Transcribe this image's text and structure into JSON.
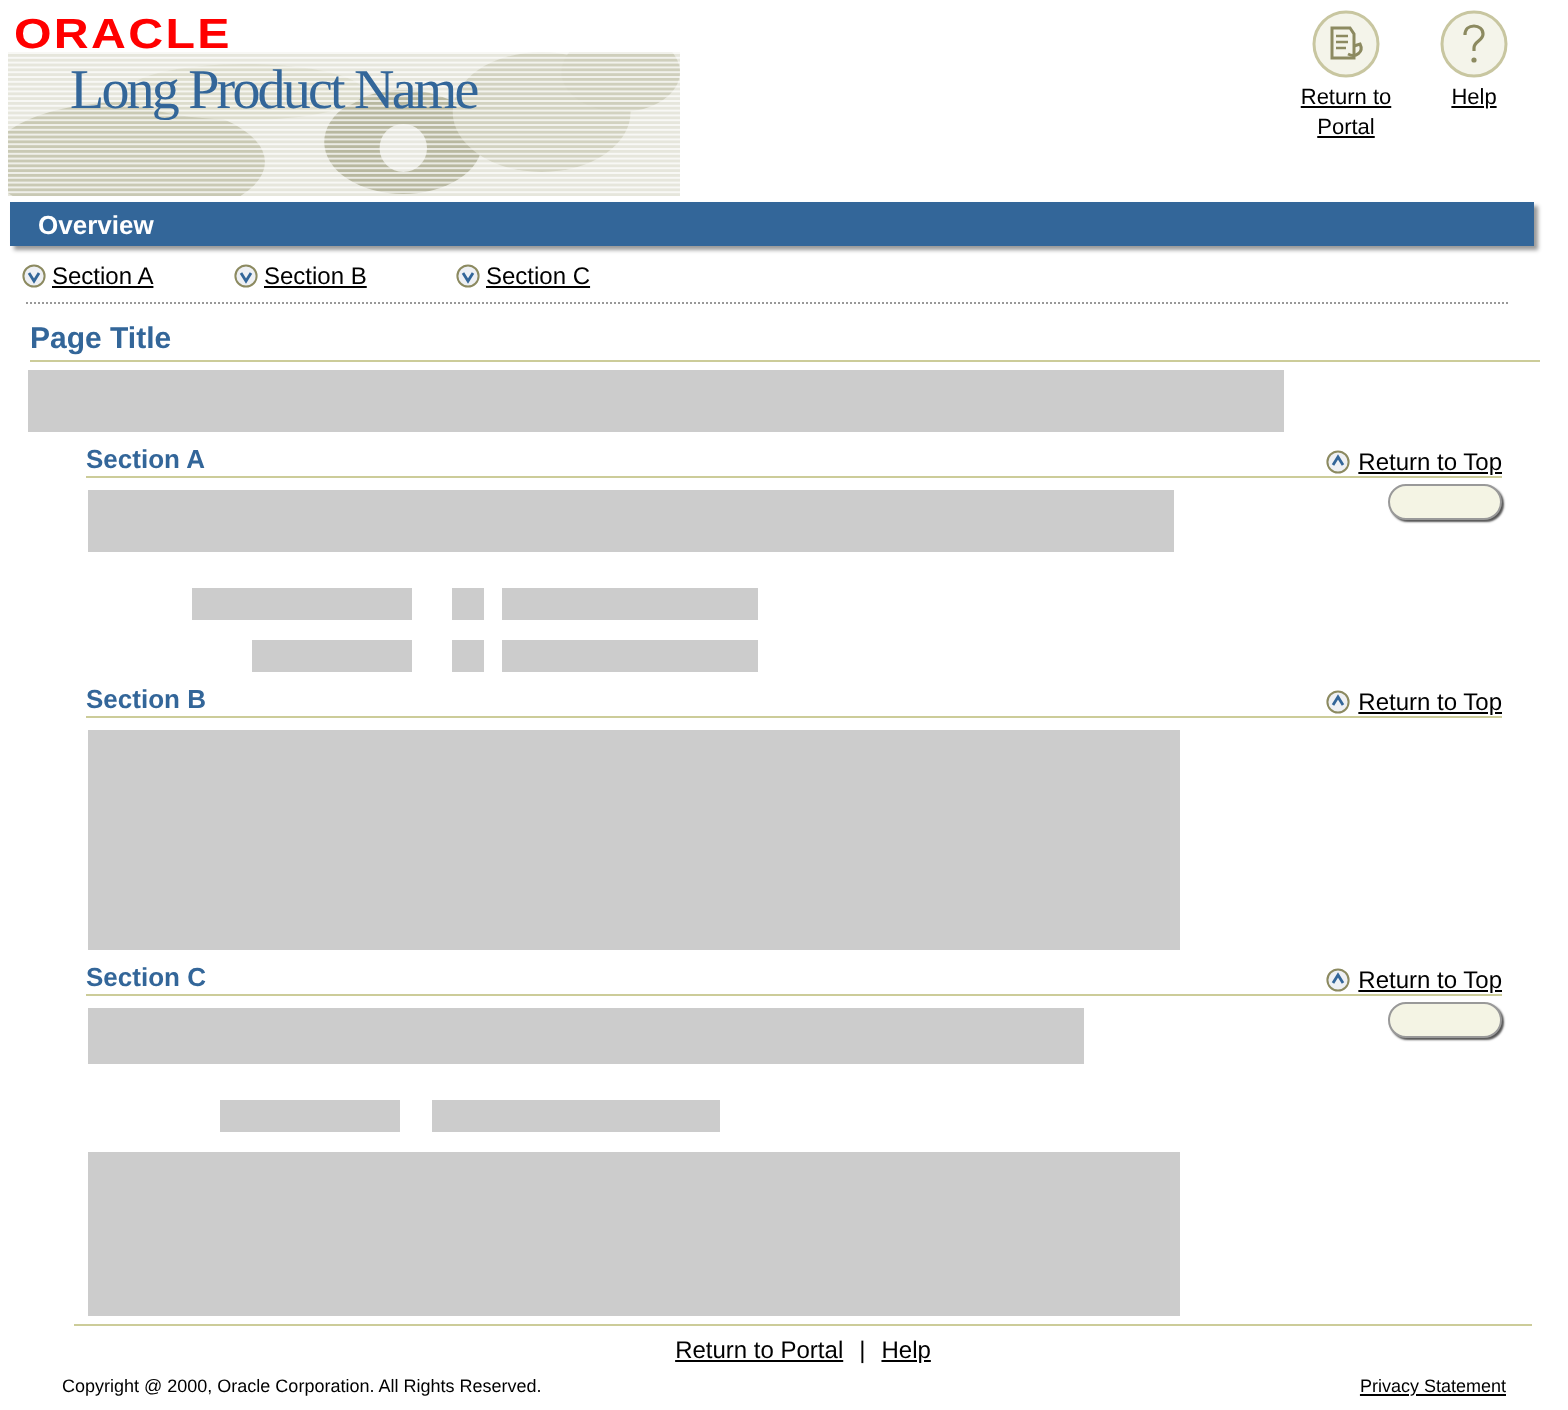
{
  "header": {
    "logo": "ORACLE",
    "product_name": "Long Product Name",
    "global_buttons": [
      {
        "label": "Return to Portal"
      },
      {
        "label": "Help"
      }
    ]
  },
  "tab_bar": {
    "label": "Overview"
  },
  "section_links": [
    "Section A",
    "Section B",
    "Section C"
  ],
  "page_title": "Page Title",
  "sections": [
    {
      "title": "Section A",
      "return_link": "Return to Top"
    },
    {
      "title": "Section B",
      "return_link": "Return to Top"
    },
    {
      "title": "Section C",
      "return_link": "Return to Top"
    }
  ],
  "footer": {
    "links": [
      "Return to Portal",
      "Help"
    ],
    "separator": "|",
    "copyright": "Copyright @ 2000, Oracle Corporation. All Rights Reserved.",
    "privacy_link": "Privacy Statement"
  }
}
